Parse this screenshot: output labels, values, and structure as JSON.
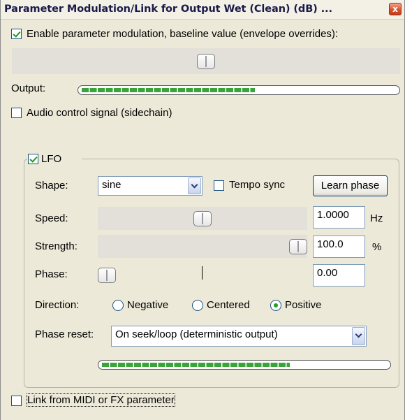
{
  "window": {
    "title": "Parameter Modulation/Link for Output Wet (Clean) (dB) ...",
    "close_glyph": "x"
  },
  "baseline": {
    "enable_label": "Enable parameter modulation, baseline value (envelope overrides):",
    "enabled": true,
    "slider_fraction": 0.5
  },
  "output": {
    "label": "Output:",
    "level_fraction": 0.55
  },
  "audio_control": {
    "label": "Audio control signal (sidechain)",
    "checked": false
  },
  "lfo": {
    "label": "LFO",
    "checked": true,
    "shape": {
      "label": "Shape:",
      "value": "sine"
    },
    "tempo_sync": {
      "label": "Tempo sync",
      "checked": false
    },
    "learn_phase_label": "Learn phase",
    "speed": {
      "label": "Speed:",
      "value": "1.0000",
      "unit": "Hz",
      "slider_fraction": 0.5
    },
    "strength": {
      "label": "Strength:",
      "value": "100.0",
      "unit": "%",
      "slider_fraction": 1.0
    },
    "phase": {
      "label": "Phase:",
      "value": "0.00",
      "slider_fraction": 0.0
    },
    "direction": {
      "label": "Direction:",
      "options": [
        "Negative",
        "Centered",
        "Positive"
      ],
      "selected": "Positive"
    },
    "phase_reset": {
      "label": "Phase reset:",
      "value": "On seek/loop (deterministic output)"
    },
    "output_level_fraction": 0.66
  },
  "link": {
    "label": "Link from MIDI or FX parameter",
    "checked": false
  },
  "colors": {
    "meter_green": "#3aa33a",
    "check_green": "#1c9a1c",
    "title_text": "#1b1b4a"
  }
}
